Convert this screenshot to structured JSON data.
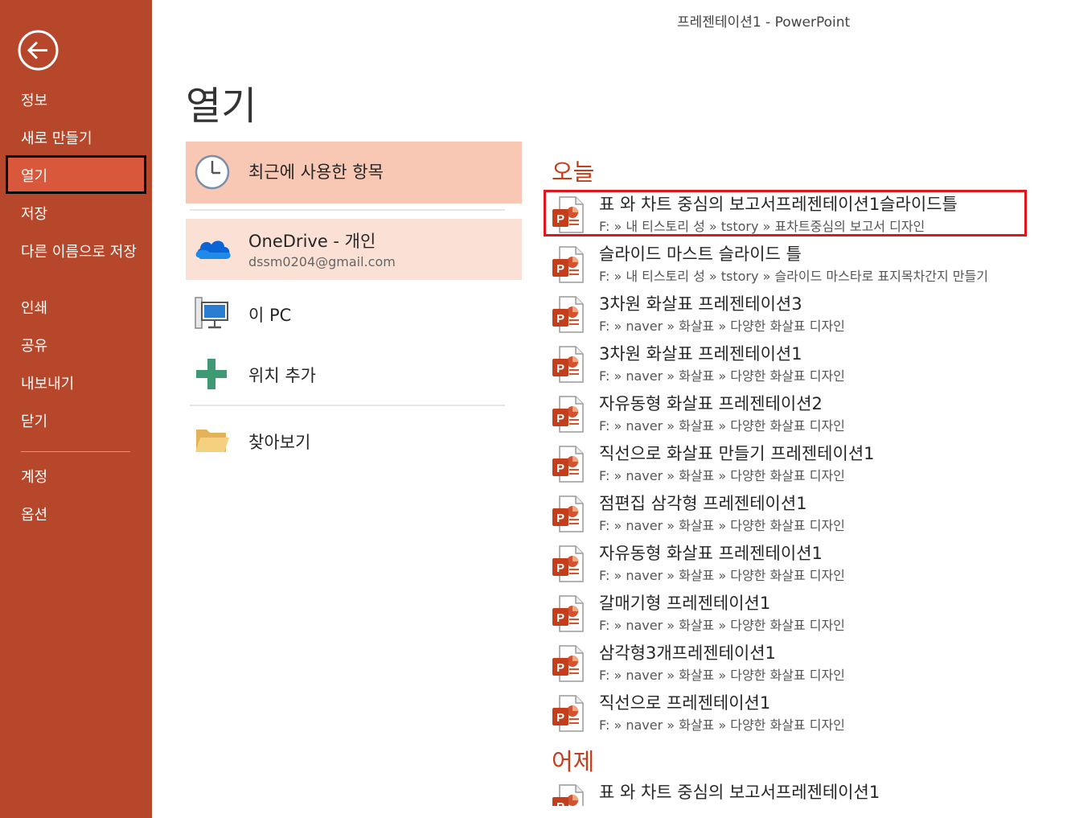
{
  "window": {
    "title": "프레젠테이션1 - PowerPoint"
  },
  "sidebar": {
    "back_icon": "back-arrow-icon",
    "items": [
      {
        "label": "정보"
      },
      {
        "label": "새로 만들기"
      },
      {
        "label": "열기"
      },
      {
        "label": "저장"
      },
      {
        "label": "다른 이름으로 저장"
      },
      {
        "label": "인쇄"
      },
      {
        "label": "공유"
      },
      {
        "label": "내보내기"
      },
      {
        "label": "닫기"
      },
      {
        "label": "계정"
      },
      {
        "label": "옵션"
      }
    ],
    "selected": "열기",
    "colors": {
      "background": "#b7472a",
      "selected": "#d9573a"
    }
  },
  "page": {
    "title": "열기"
  },
  "locations": [
    {
      "label": "최근에 사용한 항목",
      "icon": "clock-icon"
    },
    {
      "label": "OneDrive - 개인",
      "sub": "dssm0204@gmail.com",
      "icon": "onedrive-cloud-icon"
    },
    {
      "label": "이 PC",
      "icon": "computer-icon"
    },
    {
      "label": "위치 추가",
      "icon": "plus-icon"
    },
    {
      "label": "찾아보기",
      "icon": "folder-icon"
    }
  ],
  "recent": {
    "today_label": "오늘",
    "yesterday_label": "어제",
    "today": [
      {
        "name": "표 와 차트 중심의 보고서프레젠테이션1슬라이드틀",
        "path": "F: » 내 티스토리 성 » tstory » 표차트중심의 보고서 디자인"
      },
      {
        "name": "슬라이드 마스트 슬라이드 틀",
        "path": "F: » 내 티스토리 성 » tstory » 슬라이드 마스타로 표지목차간지 만들기"
      },
      {
        "name": "3차원 화살표 프레젠테이션3",
        "path": "F: » naver » 화살표 » 다양한 화살표 디자인"
      },
      {
        "name": "3차원 화살표 프레젠테이션1",
        "path": "F: » naver » 화살표 » 다양한 화살표 디자인"
      },
      {
        "name": "자유동형 화살표 프레젠테이션2",
        "path": "F: » naver » 화살표 » 다양한 화살표 디자인"
      },
      {
        "name": "직선으로 화살표 만들기 프레젠테이션1",
        "path": "F: » naver » 화살표 » 다양한 화살표 디자인"
      },
      {
        "name": "점편집 삼각형 프레젠테이션1",
        "path": "F: » naver » 화살표 » 다양한 화살표 디자인"
      },
      {
        "name": "자유동형 화살표 프레젠테이션1",
        "path": "F: » naver » 화살표 » 다양한 화살표 디자인"
      },
      {
        "name": "갈매기형 프레젠테이션1",
        "path": "F: » naver » 화살표 » 다양한 화살표 디자인"
      },
      {
        "name": "삼각형3개프레젠테이션1",
        "path": "F: » naver » 화살표 » 다양한 화살표 디자인"
      },
      {
        "name": "직선으로 프레젠테이션1",
        "path": "F: » naver » 화살표 » 다양한 화살표 디자인"
      }
    ],
    "yesterday": [
      {
        "name": "표 와 차트 중심의 보고서프레젠테이션1"
      }
    ],
    "file_icon": "powerpoint-file-icon",
    "accent_color": "#c43e1c",
    "highlight_color": "#e0161c"
  }
}
